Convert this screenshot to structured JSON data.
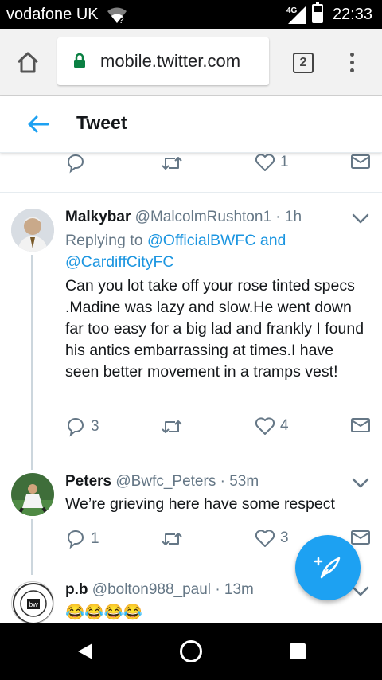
{
  "status_bar": {
    "carrier": "vodafone UK",
    "network": "4G",
    "time": "22:33"
  },
  "browser": {
    "url": "mobile.twitter.com",
    "tab_count": "2"
  },
  "header": {
    "title": "Tweet"
  },
  "top_actions": {
    "reply_count": "",
    "retweet_count": "",
    "like_count": "1"
  },
  "tweets": [
    {
      "name": "Malkybar",
      "handle": "@MalcolmRushton1",
      "dot": "·",
      "time": "1h",
      "replying_prefix": "Replying to",
      "mention_1": "@OfficialBWFC",
      "and": "and",
      "mention_2": "@CardiffCityFC",
      "text": "Can you lot take off your rose tinted specs .Madine was lazy and slow.He went down far too easy for a big lad and frankly I found his antics embarrassing at times.I have seen better movement in a tramps vest!",
      "reply_count": "3",
      "retweet_count": "",
      "like_count": "4"
    },
    {
      "name": "Peters",
      "handle": "@Bwfc_Peters",
      "dot": "·",
      "time": "53m",
      "text": "We’re grieving here have some respect",
      "reply_count": "1",
      "retweet_count": "",
      "like_count": "3"
    },
    {
      "name": "p.b",
      "handle": "@bolton988_paul",
      "dot": "·",
      "time": "13m",
      "text": "😂😂😂😂"
    }
  ],
  "colors": {
    "twitter_blue": "#1da1f2",
    "mention_blue": "#1b95e0",
    "muted_gray": "#657786",
    "border": "#e6ecf0"
  }
}
